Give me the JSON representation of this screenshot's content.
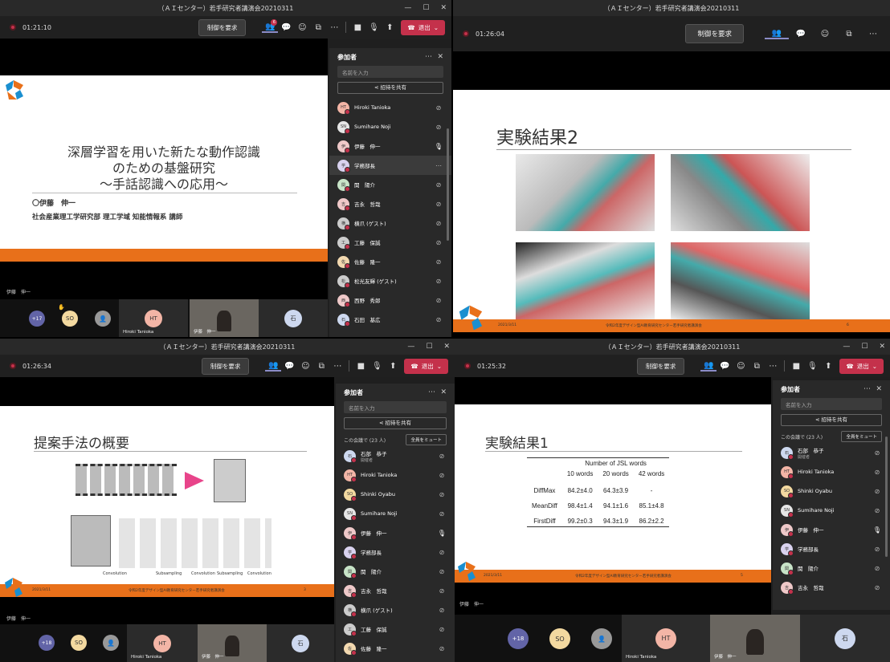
{
  "window_title": "（ＡＩセンター）若手研究者講演会20210311",
  "toolbar": {
    "request_control": "制御を要求",
    "leave": "退出",
    "badge": "6"
  },
  "timers": {
    "top_left": "01:21:10",
    "top_right": "01:26:04",
    "bottom_left": "01:26:34",
    "bottom_right": "01:25:32"
  },
  "panel": {
    "title": "参加者",
    "search_placeholder": "名前を入力",
    "share_invite": "招待を共有",
    "section_label": "この会議で (23 人)",
    "mute_all": "全員をミュート"
  },
  "colors": {
    "accent": "#8b8cc7",
    "leave": "#c4314b",
    "orange": "#e8701a",
    "panel": "#292929"
  },
  "tl_participants": [
    {
      "initials": "HT",
      "name": "Hiroki Tanioka",
      "color": "#f3b5a6"
    },
    {
      "initials": "SN",
      "name": "Sumihare Noji",
      "color": "#e6e6e6"
    },
    {
      "initials": "伊",
      "name": "伊藤　伸一",
      "color": "#efc9c9",
      "speaking": true
    },
    {
      "initials": "学",
      "name": "学務部長",
      "color": "#d9d2ef",
      "selected": true
    },
    {
      "initials": "関",
      "name": "関　陽介",
      "color": "#c8e4c8"
    },
    {
      "initials": "吉",
      "name": "吉永　哲哉",
      "color": "#efc9c9"
    },
    {
      "initials": "横",
      "name": "横爪 (ゲスト)",
      "color": "#ccc"
    },
    {
      "initials": "工",
      "name": "工藤　保誠",
      "color": "#ccc"
    },
    {
      "initials": "佐",
      "name": "佐藤　隆一",
      "color": "#f3d9b0"
    },
    {
      "initials": "松",
      "name": "松光友輝 (ゲスト)",
      "color": "#ccc"
    },
    {
      "initials": "西",
      "name": "西野　秀郎",
      "color": "#efc9c9"
    },
    {
      "initials": "石",
      "name": "石田　基広",
      "color": "#cdd8ef"
    }
  ],
  "bl_participants": [
    {
      "initials": "石",
      "name": "石部　恭子",
      "sub": "開催者",
      "color": "#cdd8ef"
    },
    {
      "initials": "HT",
      "name": "Hiroki Tanioka",
      "color": "#f3b5a6"
    },
    {
      "initials": "SO",
      "name": "Shinki Oyabu",
      "color": "#f3d9a0"
    },
    {
      "initials": "SN",
      "name": "Sumihare Noji",
      "color": "#e6e6e6"
    },
    {
      "initials": "伊",
      "name": "伊藤　伸一",
      "color": "#efc9c9",
      "speaking": true
    },
    {
      "initials": "学",
      "name": "学務部長",
      "color": "#d9d2ef"
    },
    {
      "initials": "関",
      "name": "関　陽介",
      "color": "#c8e4c8"
    },
    {
      "initials": "吉",
      "name": "吉永　哲哉",
      "color": "#efc9c9"
    },
    {
      "initials": "横",
      "name": "横爪 (ゲスト)",
      "color": "#ccc"
    },
    {
      "initials": "工",
      "name": "工藤　保誠",
      "color": "#ccc"
    },
    {
      "initials": "佐",
      "name": "佐藤　隆一",
      "color": "#f3d9b0"
    }
  ],
  "br_participants": [
    {
      "initials": "石",
      "name": "石部　恭子",
      "sub": "開催者",
      "color": "#cdd8ef"
    },
    {
      "initials": "HT",
      "name": "Hiroki Tanioka",
      "color": "#f3b5a6"
    },
    {
      "initials": "SO",
      "name": "Shinki Oyabu",
      "color": "#f3d9a0"
    },
    {
      "initials": "SN",
      "name": "Sumihare Noji",
      "color": "#e6e6e6"
    },
    {
      "initials": "伊",
      "name": "伊藤　伸一",
      "color": "#efc9c9",
      "speaking": true
    },
    {
      "initials": "学",
      "name": "学務部長",
      "color": "#d9d2ef"
    },
    {
      "initials": "関",
      "name": "関　陽介",
      "color": "#c8e4c8"
    },
    {
      "initials": "吉",
      "name": "吉永　哲哉",
      "color": "#efc9c9"
    }
  ],
  "strip": {
    "more": "+17",
    "more2": "+18",
    "so": "SO",
    "ht": "HT",
    "ishi": "石",
    "ht_label": "Hiroki Tanioka",
    "ito_label": "伊藤　伸一"
  },
  "presenter_label": "伊藤　伸一",
  "slide_tl": {
    "title1": "深層学習を用いた新たな動作認識",
    "title2": "のための基盤研究",
    "title3": "〜手話認識への応用〜",
    "author": "〇伊藤　伸一",
    "affil": "社会産業理工学研究部 理工学域 知能情報系 講師"
  },
  "slide_tr": {
    "title": "実験結果2",
    "footer_date": "2021/3/11",
    "footer_center": "令和2年度デザイン型AI教育研究センター若手研究者講演会",
    "page": "6"
  },
  "slide_bl": {
    "title": "提案手法の概要",
    "labels": [
      "Convolution",
      "Subsampling",
      "Convolution",
      "Subsampling",
      "Convolution"
    ],
    "footer_date": "2021/3/11",
    "footer_center": "令和2年度デザイン型AI教育研究センター若手研究者講演会",
    "page": "3"
  },
  "slide_br": {
    "title": "実験結果1",
    "header": "Number of JSL words",
    "cols": [
      "10 words",
      "20 words",
      "42 words"
    ],
    "rows": [
      {
        "label": "DiffMax",
        "v": [
          "84.2±4.0",
          "64.3±3.9",
          "-"
        ]
      },
      {
        "label": "MeanDiff",
        "v": [
          "98.4±1.4",
          "94.1±1.6",
          "85.1±4.8"
        ]
      },
      {
        "label": "FirstDiff",
        "v": [
          "99.2±0.3",
          "94.3±1.9",
          "86.2±2.2"
        ]
      }
    ],
    "footer_date": "2021/3/11",
    "footer_center": "令和2年度デザイン型AI教育研究センター若手研究者講演会",
    "page": "5"
  }
}
